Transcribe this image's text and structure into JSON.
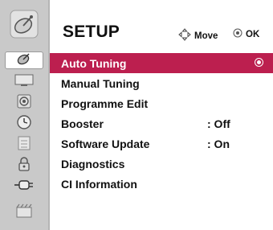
{
  "header": {
    "title": "SETUP",
    "move_label": "Move",
    "ok_label": "OK"
  },
  "menu": {
    "items": [
      {
        "label": "Auto Tuning",
        "value": "",
        "selected": true
      },
      {
        "label": "Manual Tuning",
        "value": ""
      },
      {
        "label": "Programme Edit",
        "value": ""
      },
      {
        "label": "Booster",
        "value": ": Off"
      },
      {
        "label": "Software Update",
        "value": ": On"
      },
      {
        "label": "Diagnostics",
        "value": ""
      },
      {
        "label": "CI Information",
        "value": ""
      }
    ]
  },
  "sidebar": {
    "icons": [
      "satellite-dish-icon",
      "tv-screen-icon",
      "speaker-icon",
      "clock-icon",
      "lock-icon",
      "padlock-icon",
      "plug-icon",
      "film-icon"
    ]
  },
  "colors": {
    "accent": "#bc1f4f",
    "rail": "#c9c9c9"
  }
}
